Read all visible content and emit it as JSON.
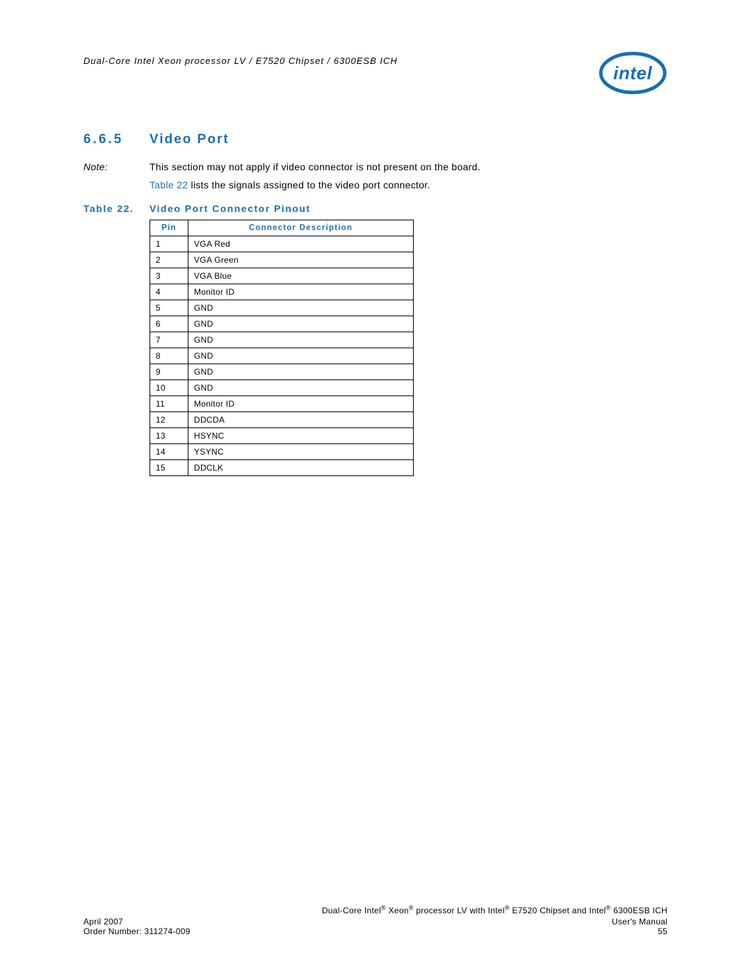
{
  "header": {
    "running_title": "Dual-Core Intel Xeon processor LV / E7520 Chipset / 6300ESB ICH",
    "logo_alt": "intel"
  },
  "section": {
    "number": "6.6.5",
    "title": "Video Port"
  },
  "note": {
    "label": "Note:",
    "text": "This section may not apply if video connector is not present on the board."
  },
  "body": {
    "xref": "Table 22",
    "rest": " lists the signals assigned to the video port connector."
  },
  "table_caption": {
    "number": "Table 22.",
    "title": "Video Port Connector Pinout"
  },
  "table": {
    "headers": {
      "pin": "Pin",
      "desc": "Connector Description"
    },
    "rows": [
      {
        "pin": "1",
        "desc": "VGA Red"
      },
      {
        "pin": "2",
        "desc": "VGA Green"
      },
      {
        "pin": "3",
        "desc": "VGA Blue"
      },
      {
        "pin": "4",
        "desc": "Monitor ID"
      },
      {
        "pin": "5",
        "desc": "GND"
      },
      {
        "pin": "6",
        "desc": "GND"
      },
      {
        "pin": "7",
        "desc": "GND"
      },
      {
        "pin": "8",
        "desc": "GND"
      },
      {
        "pin": "9",
        "desc": "GND"
      },
      {
        "pin": "10",
        "desc": "GND"
      },
      {
        "pin": "11",
        "desc": "Monitor ID"
      },
      {
        "pin": "12",
        "desc": "DDCDA"
      },
      {
        "pin": "13",
        "desc": "HSYNC"
      },
      {
        "pin": "14",
        "desc": "YSYNC"
      },
      {
        "pin": "15",
        "desc": "DDCLK"
      }
    ]
  },
  "footer": {
    "product_line_a": "Dual-Core Intel",
    "product_line_b": " Xeon",
    "product_line_c": " processor LV with Intel",
    "product_line_d": " E7520 Chipset and Intel",
    "product_line_e": " 6300ESB ICH",
    "date": "April 2007",
    "manual": "User's Manual",
    "order": "Order Number: 311274-009",
    "page": "55",
    "reg": "®"
  }
}
